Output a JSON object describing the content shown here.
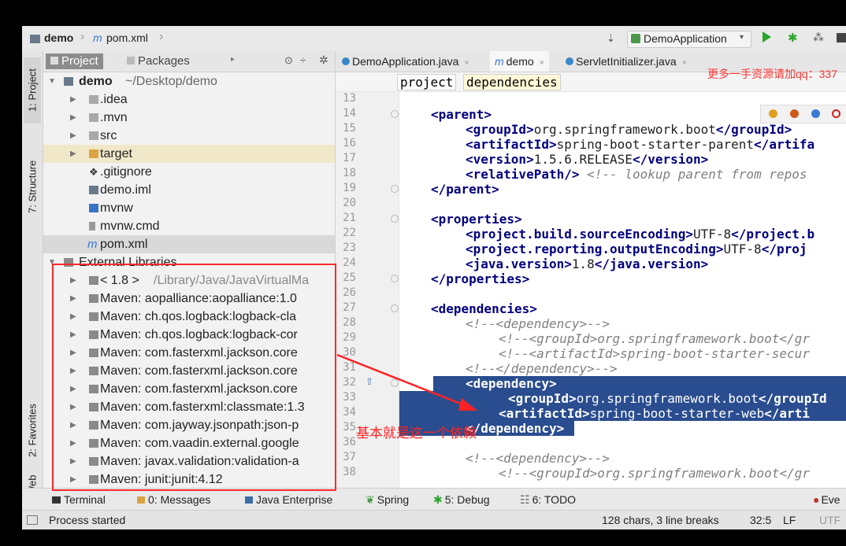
{
  "navbar": {
    "crumb_project": "demo",
    "crumb_file": "pom.xml",
    "run_config": "DemoApplication"
  },
  "left_strip": {
    "project": "1: Project",
    "structure": "7: Structure",
    "favorites": "2: Favorites",
    "web": "Web"
  },
  "project_panel": {
    "tab_project": "Project",
    "tab_packages": "Packages",
    "root_name": "demo",
    "root_path": "~/Desktop/demo",
    "items": [
      ".idea",
      ".mvn",
      "src",
      "target",
      ".gitignore",
      "demo.iml",
      "mvnw",
      "mvnw.cmd",
      "pom.xml"
    ],
    "external_libraries": "External Libraries",
    "libraries": [
      "< 1.8 >",
      "Maven: aopalliance:aopalliance:1.0",
      "Maven: ch.qos.logback:logback-cla",
      "Maven: ch.qos.logback:logback-cor",
      "Maven: com.fasterxml.jackson.core",
      "Maven: com.fasterxml.jackson.core",
      "Maven: com.fasterxml.jackson.core",
      "Maven: com.fasterxml:classmate:1.3",
      "Maven: com.jayway.jsonpath:json-p",
      "Maven: com.vaadin.external.google",
      "Maven: javax.validation:validation-a",
      "Maven: junit:junit:4.12"
    ],
    "jdk_path": "/Library/Java/JavaVirtualMa"
  },
  "editor": {
    "tabs": [
      "DemoApplication.java",
      "demo",
      "ServletInitializer.java"
    ],
    "breadcrumb": [
      "project",
      "dependencies"
    ],
    "line_numbers": [
      13,
      14,
      15,
      16,
      17,
      18,
      19,
      20,
      21,
      22,
      23,
      24,
      25,
      26,
      27,
      28,
      29,
      30,
      31,
      32,
      33,
      34,
      35,
      36,
      37,
      38
    ],
    "lines": {
      "l14": "<parent>",
      "l15a": "<groupId>",
      "l15b": "org.springframework.boot",
      "l15c": "</groupId>",
      "l16a": "<artifactId>",
      "l16b": "spring-boot-starter-parent",
      "l16c": "</artifa",
      "l17a": "<version>",
      "l17b": "1.5.6.RELEASE",
      "l17c": "</version>",
      "l18a": "<relativePath/>",
      "l18b": "<!-- lookup parent from repos",
      "l19": "</parent>",
      "l21": "<properties>",
      "l22a": "<project.build.sourceEncoding>",
      "l22b": "UTF-8",
      "l22c": "</project.b",
      "l23a": "<project.reporting.outputEncoding>",
      "l23b": "UTF-8",
      "l23c": "</proj",
      "l24a": "<java.version>",
      "l24b": "1.8",
      "l24c": "</java.version>",
      "l25": "</properties>",
      "l27": "<dependencies>",
      "l28": "<!--<dependency>-->",
      "l29": "<!--<groupId>org.springframework.boot</gr",
      "l30": "<!--<artifactId>spring-boot-starter-secur",
      "l31": "<!--</dependency>-->",
      "l32": "<dependency>",
      "l33a": "<groupId>",
      "l33b": "org.springframework.boot",
      "l33c": "</groupId",
      "l34a": "<artifactId>",
      "l34b": "spring-boot-starter-web",
      "l34c": "</arti",
      "l35": "</dependency>",
      "l37": "<!--<dependency>-->",
      "l38": "<!--<groupId>org.springframework.boot</gr"
    }
  },
  "bottom_tools": [
    "Terminal",
    "0: Messages",
    "Java Enterprise",
    "Spring",
    "5: Debug",
    "6: TODO",
    "Eve"
  ],
  "status": {
    "message": "Process started",
    "selection": "128 chars, 3 line breaks",
    "position": "32:5",
    "line_sep": "LF",
    "encoding": "UTF"
  },
  "annotation": "基本就是这一个依赖",
  "watermark": "更多一手资源请加qq：337",
  "colors": {
    "selection": "#2a4d8f",
    "tag": "#000080",
    "annotation": "#ff2222"
  }
}
